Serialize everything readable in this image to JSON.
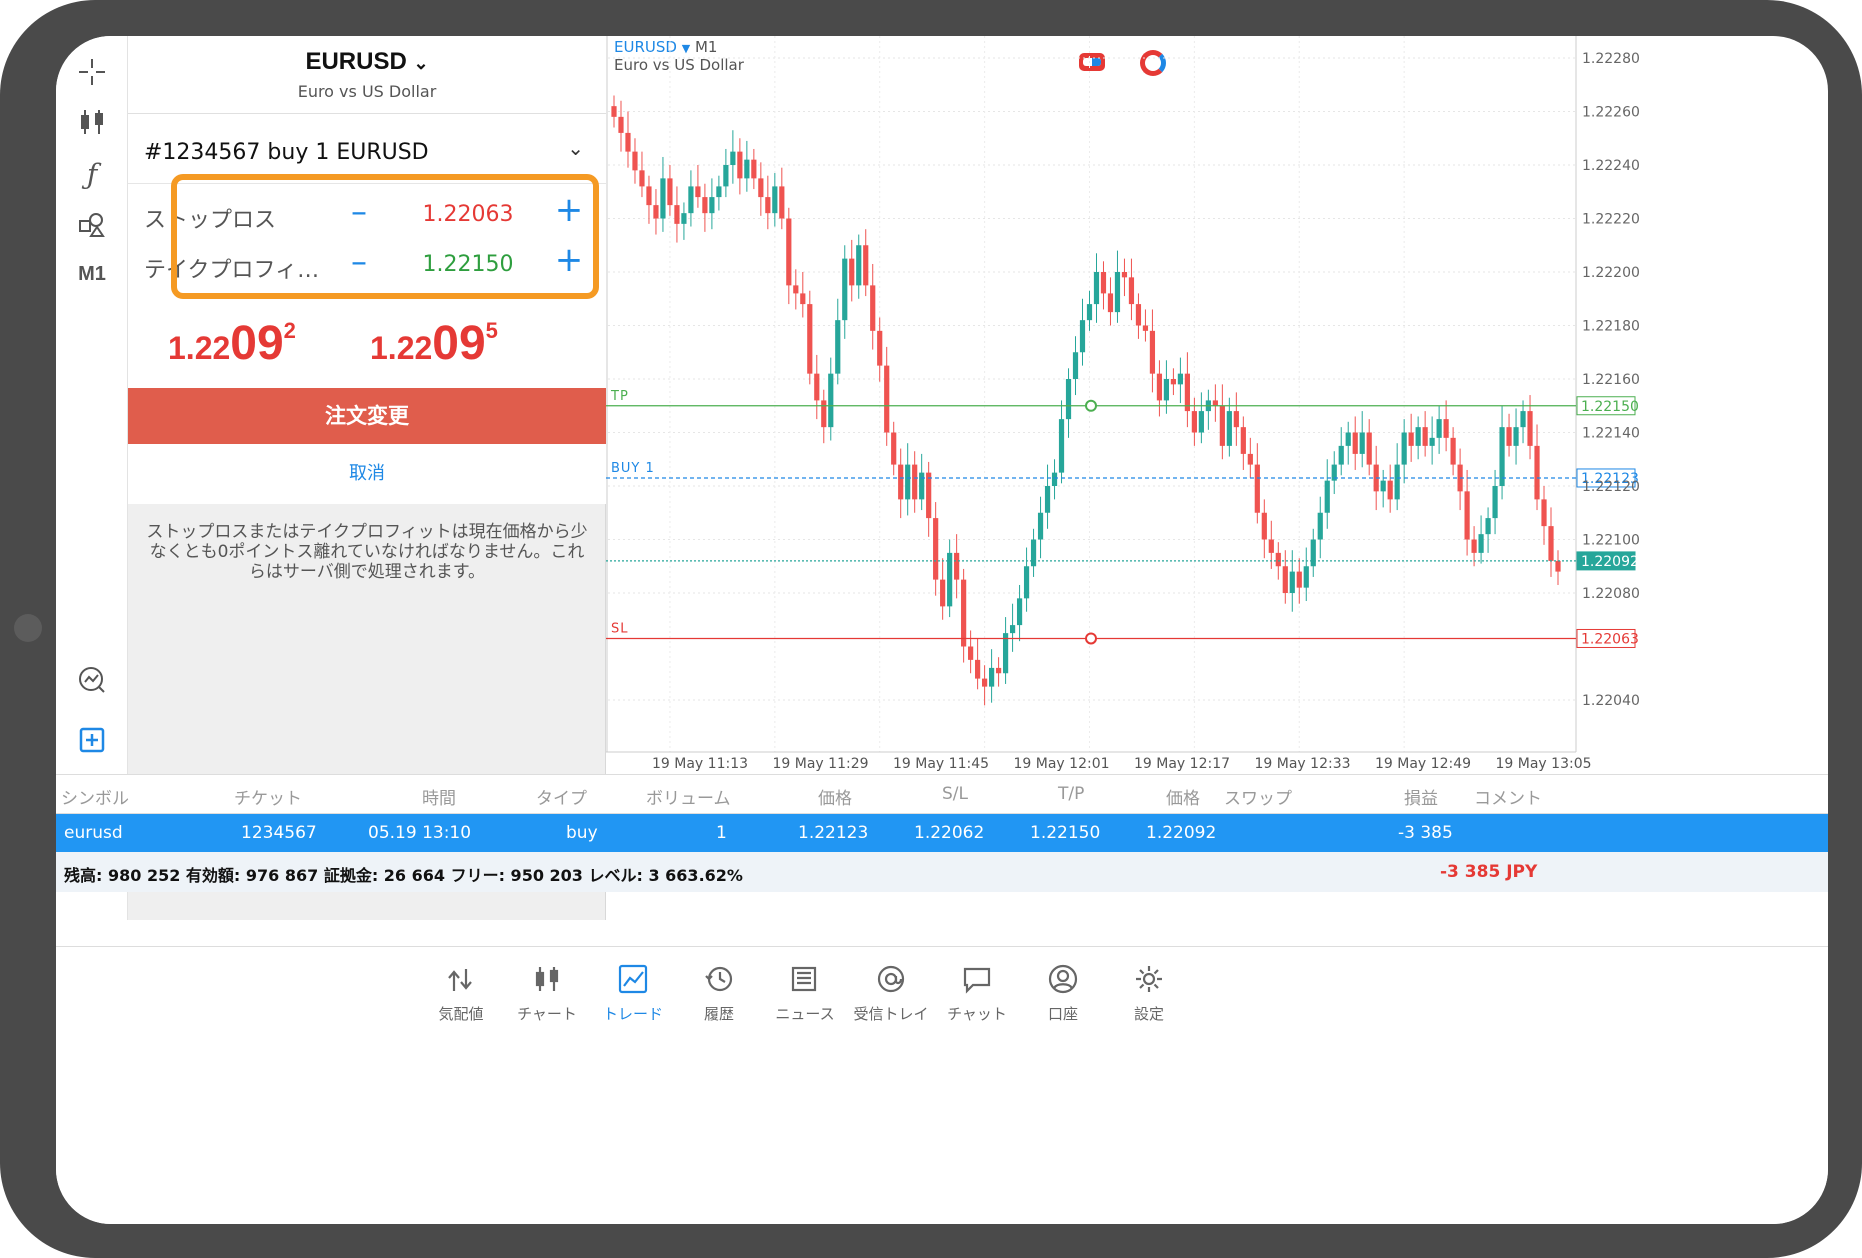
{
  "symbol": {
    "name": "EURUSD",
    "description": "Euro vs US Dollar"
  },
  "toolbar": {
    "timeframe": "M1"
  },
  "order": {
    "selector": "#1234567 buy 1 EURUSD",
    "stop_loss": {
      "label": "ストップロス",
      "value": "1.22063"
    },
    "take_profit": {
      "label": "テイクプロフィ…",
      "value": "1.22150"
    },
    "bid": {
      "a": "1.22",
      "b": "09",
      "c": "2"
    },
    "ask": {
      "a": "1.22",
      "b": "09",
      "c": "5"
    },
    "modify_label": "注文変更",
    "cancel_label": "取消",
    "note": "ストップロスまたはテイクプロフィットは現在価格から少なくとも0ポイントス離れていなければなりません。これらはサーバ側で処理されます。"
  },
  "chart": {
    "symbol": "EURUSD",
    "timeframe": "M1",
    "description": "Euro vs US Dollar",
    "line_labels": {
      "tp": "TP",
      "buy": "BUY 1",
      "sl": "SL"
    },
    "colors": {
      "bull": "#26a69a",
      "bear": "#ef5350",
      "tp": "#4caf50",
      "sl": "#e53935",
      "buy": "#1e88e5"
    }
  },
  "chart_data": {
    "type": "candlestick",
    "y_ticks": [
      "1.22280",
      "1.22260",
      "1.22240",
      "1.22220",
      "1.22200",
      "1.22180",
      "1.22160",
      "1.22140",
      "1.22120",
      "1.22100",
      "1.22080",
      "1.22040"
    ],
    "x_ticks": [
      "19 May 11:13",
      "19 May 11:29",
      "19 May 11:45",
      "19 May 12:01",
      "19 May 12:17",
      "19 May 12:33",
      "19 May 12:49",
      "19 May 13:05"
    ],
    "ylim": [
      1.2203,
      1.22283
    ],
    "levels": {
      "tp": "1.22150",
      "buy": "1.22123",
      "current": "1.22092",
      "sl": "1.22063"
    },
    "closes": [
      1.22258,
      1.22252,
      1.22245,
      1.22238,
      1.22232,
      1.22225,
      1.2222,
      1.22235,
      1.22225,
      1.22218,
      1.22222,
      1.22232,
      1.22228,
      1.22222,
      1.22228,
      1.22232,
      1.2224,
      1.22245,
      1.22235,
      1.22242,
      1.22235,
      1.22228,
      1.22222,
      1.22232,
      1.2222,
      1.22195,
      1.22192,
      1.22188,
      1.22162,
      1.22152,
      1.22142,
      1.22162,
      1.22182,
      1.22205,
      1.22195,
      1.2221,
      1.22195,
      1.22178,
      1.22165,
      1.2214,
      1.22128,
      1.22115,
      1.22128,
      1.22115,
      1.22125,
      1.22108,
      1.22085,
      1.22075,
      1.22095,
      1.22085,
      1.2206,
      1.22055,
      1.22048,
      1.22045,
      1.22052,
      1.2205,
      1.22065,
      1.22068,
      1.22078,
      1.2209,
      1.221,
      1.2211,
      1.2212,
      1.22125,
      1.22145,
      1.2216,
      1.2217,
      1.22182,
      1.22188,
      1.222,
      1.22192,
      1.22185,
      1.222,
      1.22198,
      1.22188,
      1.2218,
      1.22178,
      1.22162,
      1.22152,
      1.2216,
      1.22158,
      1.22162,
      1.22148,
      1.2214,
      1.22148,
      1.22152,
      1.2215,
      1.22135,
      1.22148,
      1.22142,
      1.22132,
      1.22128,
      1.2211,
      1.221,
      1.22095,
      1.2209,
      1.2208,
      1.22088,
      1.22082,
      1.2209,
      1.221,
      1.2211,
      1.22122,
      1.22128,
      1.22135,
      1.2214,
      1.22132,
      1.2214,
      1.22128,
      1.22118,
      1.22122,
      1.22115,
      1.22128,
      1.2214,
      1.22135,
      1.22142,
      1.22135,
      1.22138,
      1.22145,
      1.22138,
      1.22128,
      1.22118,
      1.221,
      1.22095,
      1.22102,
      1.22108,
      1.2212,
      1.22142,
      1.22135,
      1.22142,
      1.22148,
      1.22135,
      1.22115,
      1.22105,
      1.22092,
      1.22088
    ]
  },
  "positions": {
    "headers": [
      "シンボル",
      "チケット",
      "時間",
      "タイプ",
      "ボリューム",
      "価格",
      "S/L",
      "T/P",
      "価格",
      "スワップ",
      "損益",
      "コメント"
    ],
    "row": [
      "eurusd",
      "1234567",
      "05.19 13:10",
      "buy",
      "1",
      "1.22123",
      "1.22062",
      "1.22150",
      "1.22092",
      "",
      "-3 385",
      ""
    ],
    "balance": "残高: 980 252 有効額: 976 867 証拠金: 26 664 フリー: 950 203 レベル: 3 663.62%",
    "pl": "-3 385  JPY"
  },
  "nav": [
    {
      "label": "気配値",
      "icon": "quotes-icon"
    },
    {
      "label": "チャート",
      "icon": "chart-icon"
    },
    {
      "label": "トレード",
      "icon": "trade-icon"
    },
    {
      "label": "履歴",
      "icon": "history-icon"
    },
    {
      "label": "ニュース",
      "icon": "news-icon"
    },
    {
      "label": "受信トレイ",
      "icon": "mailbox-icon"
    },
    {
      "label": "チャット",
      "icon": "chat-icon"
    },
    {
      "label": "口座",
      "icon": "account-icon"
    },
    {
      "label": "設定",
      "icon": "settings-icon"
    }
  ]
}
